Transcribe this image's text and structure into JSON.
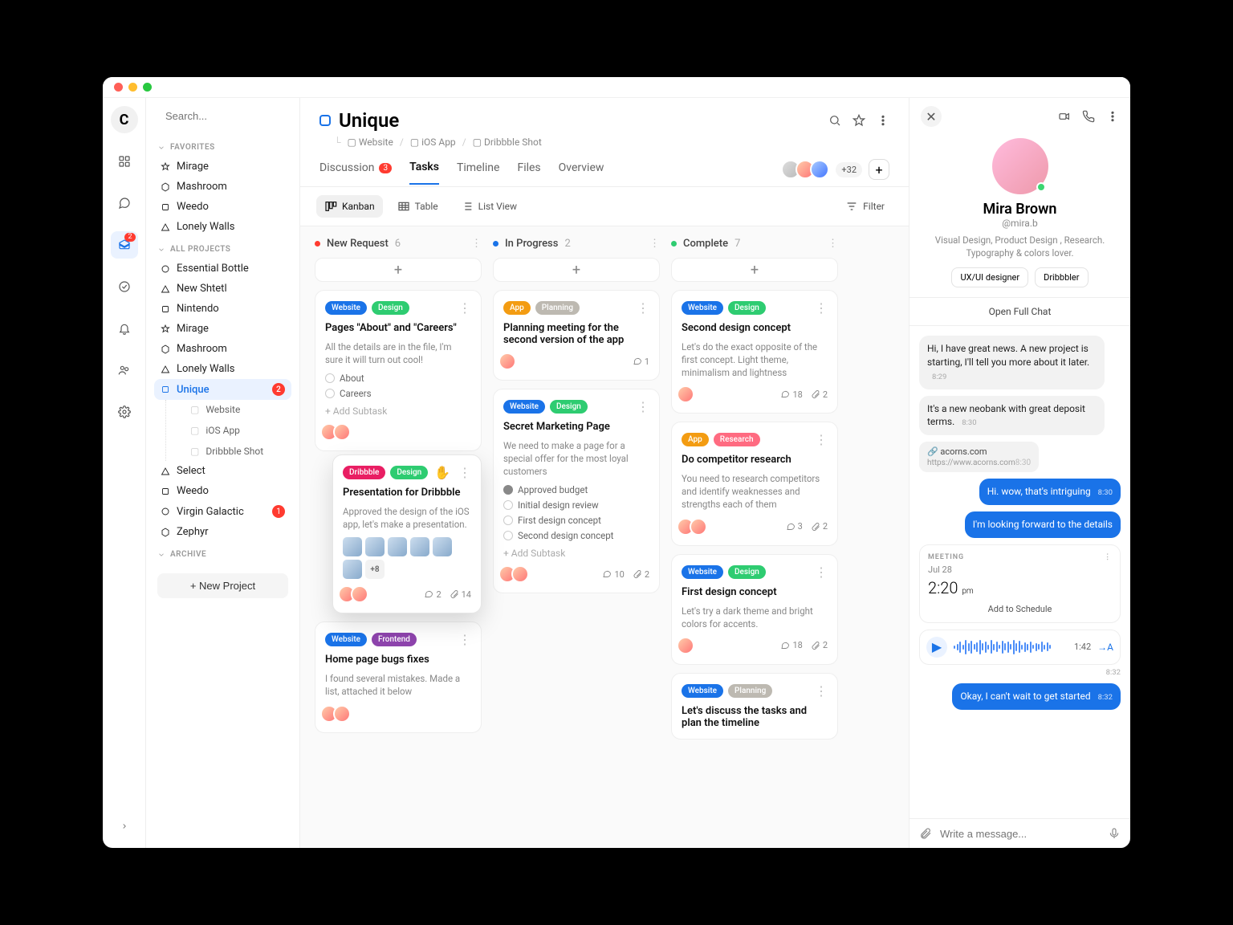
{
  "search": {
    "placeholder": "Search..."
  },
  "rail": {
    "inbox_badge": "2"
  },
  "sidebar": {
    "favorites_label": "FAVORITES",
    "favorites": [
      {
        "label": "Mirage",
        "color": "#f5a623",
        "shape": "star"
      },
      {
        "label": "Mashroom",
        "color": "#8e44ad",
        "shape": "hex"
      },
      {
        "label": "Weedo",
        "color": "#e91e63",
        "shape": "square"
      },
      {
        "label": "Lonely Walls",
        "color": "#2ecc71",
        "shape": "tri"
      }
    ],
    "all_label": "ALL PROJECTS",
    "all": [
      {
        "label": "Essential Bottle",
        "color": "#ccc",
        "shape": "circle"
      },
      {
        "label": "New Shtetl",
        "color": "#ccc",
        "shape": "tri"
      },
      {
        "label": "Nintendo",
        "color": "#ccc",
        "shape": "square"
      },
      {
        "label": "Mirage",
        "color": "#f5a623",
        "shape": "star"
      },
      {
        "label": "Mashroom",
        "color": "#8e44ad",
        "shape": "hex"
      },
      {
        "label": "Lonely Walls",
        "color": "#2ecc71",
        "shape": "tri"
      },
      {
        "label": "Unique",
        "color": "#1a73e8",
        "shape": "square",
        "active": true,
        "badge": "2"
      },
      {
        "label": "Select",
        "color": "#ccc",
        "shape": "tri"
      },
      {
        "label": "Weedo",
        "color": "#e91e63",
        "shape": "square"
      },
      {
        "label": "Virgin Galactic",
        "color": "#ccc",
        "shape": "circle",
        "badge": "1"
      },
      {
        "label": "Zephyr",
        "color": "#ccc",
        "shape": "hex"
      }
    ],
    "unique_children": [
      {
        "label": "Website"
      },
      {
        "label": "iOS App"
      },
      {
        "label": "Dribbble Shot"
      }
    ],
    "archive_label": "ARCHIVE",
    "new_project": "+ New Project"
  },
  "project": {
    "title": "Unique",
    "breadcrumb": [
      "Website",
      "iOS App",
      "Dribbble Shot"
    ],
    "members_extra": "+32",
    "tabs": [
      {
        "label": "Discussion",
        "badge": "3"
      },
      {
        "label": "Tasks",
        "active": true
      },
      {
        "label": "Timeline"
      },
      {
        "label": "Files"
      },
      {
        "label": "Overview"
      }
    ],
    "views": [
      {
        "label": "Kanban",
        "icon": "kanban",
        "active": true
      },
      {
        "label": "Table",
        "icon": "table"
      },
      {
        "label": "List View",
        "icon": "list"
      }
    ],
    "filter_label": "Filter"
  },
  "columns": [
    {
      "name": "New Request",
      "count": "6",
      "color": "#ff3b30",
      "cards": [
        {
          "tags": [
            {
              "t": "Website",
              "c": "#1a73e8"
            },
            {
              "t": "Design",
              "c": "#2ecc71"
            }
          ],
          "title": "Pages \"About\" and  \"Careers\"",
          "body": "All the details are in the file, I'm sure it will turn out cool!",
          "todos": [
            {
              "t": "About"
            },
            {
              "t": "Careers"
            }
          ],
          "add_sub": "Add Subtask",
          "assignees": 2
        },
        {
          "tags": [
            {
              "t": "Dribbble",
              "c": "#e91e63"
            },
            {
              "t": "Design",
              "c": "#2ecc71"
            }
          ],
          "title": "Presentation for Dribbble",
          "body": "Approved the design of the iOS app, let's make a presentation.",
          "thumbs": 6,
          "thumbs_more": "+8",
          "assignees": 2,
          "comments": "2",
          "attachments": "14",
          "floating": true,
          "grab": true
        },
        {
          "tags": [
            {
              "t": "Website",
              "c": "#1a73e8"
            },
            {
              "t": "Frontend",
              "c": "#8e44ad"
            }
          ],
          "title": "Home page bugs fixes",
          "body": "I found several mistakes. Made a list, attached it below",
          "assignees": 2
        }
      ]
    },
    {
      "name": "In Progress",
      "count": "2",
      "color": "#1a73e8",
      "cards": [
        {
          "tags": [
            {
              "t": "App",
              "c": "#f39c12"
            },
            {
              "t": "Planning",
              "c": "#bdb9b1"
            }
          ],
          "title": "Planning meeting for the second version of the app",
          "assignees": 1,
          "comments": "1"
        },
        {
          "tags": [
            {
              "t": "Website",
              "c": "#1a73e8"
            },
            {
              "t": "Design",
              "c": "#2ecc71"
            }
          ],
          "title": "Secret Marketing Page",
          "body": "We need to make a page for a special offer for the most loyal customers",
          "todos": [
            {
              "t": "Approved budget",
              "done": true
            },
            {
              "t": "Initial design review"
            },
            {
              "t": "First design concept"
            },
            {
              "t": "Second design concept"
            }
          ],
          "add_sub": "Add Subtask",
          "assignees": 2,
          "comments": "10",
          "attachments": "2"
        }
      ]
    },
    {
      "name": "Complete",
      "count": "7",
      "color": "#2ecc71",
      "cards": [
        {
          "tags": [
            {
              "t": "Website",
              "c": "#1a73e8"
            },
            {
              "t": "Design",
              "c": "#2ecc71"
            }
          ],
          "title": "Second design concept",
          "body": "Let's do the exact opposite of the first concept. Light theme, minimalism and lightness",
          "assignees": 1,
          "comments": "18",
          "attachments": "2"
        },
        {
          "tags": [
            {
              "t": "App",
              "c": "#f39c12"
            },
            {
              "t": "Research",
              "c": "#ff6b81"
            }
          ],
          "title": "Do competitor research",
          "body": "You need to research competitors and identify weaknesses and strengths each of them",
          "assignees": 2,
          "comments": "3",
          "attachments": "2"
        },
        {
          "tags": [
            {
              "t": "Website",
              "c": "#1a73e8"
            },
            {
              "t": "Design",
              "c": "#2ecc71"
            }
          ],
          "title": "First design concept",
          "body": "Let's try a dark theme and bright colors for accents.",
          "assignees": 1,
          "comments": "18",
          "attachments": "2"
        },
        {
          "tags": [
            {
              "t": "Website",
              "c": "#1a73e8"
            },
            {
              "t": "Planning",
              "c": "#bdb9b1"
            }
          ],
          "title": "Let's discuss the tasks and plan the timeline"
        }
      ]
    }
  ],
  "add_card_glyph": "+",
  "chat": {
    "name": "Mira Brown",
    "handle": "@mira.b",
    "bio": "Visual Design, Product Design , Research. Typography & colors lover.",
    "chips": [
      "UX/UI designer",
      "Dribbbler"
    ],
    "open_chat": "Open Full Chat",
    "messages": [
      {
        "type": "in",
        "text": "Hi, I have great news. A new project is starting, I'll tell you more about it later.",
        "ts": "8:29"
      },
      {
        "type": "in",
        "text": "It's a new neobank with great deposit terms.",
        "ts": "8:30"
      },
      {
        "type": "link",
        "title": "acorns.com",
        "url": "https://www.acorns.com",
        "ts": "8:30"
      },
      {
        "type": "out",
        "text": "Hi. wow, that's intriguing",
        "ts": "8:30"
      },
      {
        "type": "out",
        "text": "I'm looking forward to the details"
      },
      {
        "type": "meeting",
        "label": "MEETING",
        "date": "Jul 28",
        "time": "2:20",
        "ampm": "pm",
        "action": "Add to Schedule"
      },
      {
        "type": "voice",
        "duration": "1:42",
        "ts": "8:32"
      },
      {
        "type": "out",
        "text": "Okay, I can't wait to get started",
        "ts": "8:32"
      }
    ],
    "composer_placeholder": "Write a message..."
  }
}
